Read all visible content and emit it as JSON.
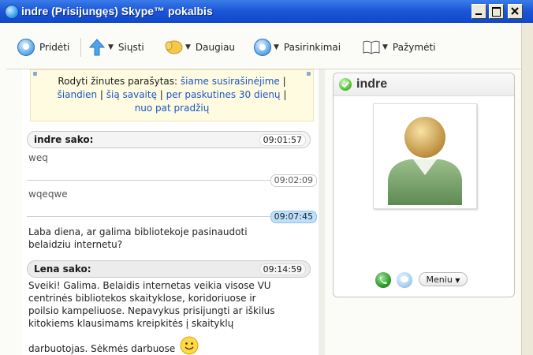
{
  "window": {
    "title": "indre (Prisijungęs) Skype™ pokalbis"
  },
  "toolbar": {
    "add_label": "Pridėti",
    "send_label": "Siųsti",
    "more_label": "Daugiau",
    "options_label": "Pasirinkimai",
    "mark_label": "Pažymėti"
  },
  "notice": {
    "prefix": "Rodyti žinutes parašytas:",
    "links": [
      "šiame susirašinėjime",
      "šiandien",
      "šią savaitę",
      "per paskutines 30 dienų",
      "nuo pat pradžių"
    ]
  },
  "messages": [
    {
      "sender": "indre sako:",
      "time": "09:01:57",
      "text": "weq"
    },
    {
      "time": "09:02:09",
      "text": "wqeqwe"
    },
    {
      "time": "09:07:45",
      "text": "Laba diena, ar galima bibliotekoje pasinaudoti belaidziu internetu?"
    },
    {
      "sender": "Lena sako:",
      "time": "09:14:59",
      "text_lines": [
        "Sveiki! Galima. Belaidis internetas veikia visose VU",
        "centrinės bibliotekos skaityklose, koridoriuose ir",
        "poilsio kampeliuose. Nepavykus prisijungti ar iškilus",
        "kitokiems klausimams kreipkitės į skaityklų",
        "darbuotojas. Sėkmės darbuose"
      ]
    }
  ],
  "contact": {
    "name": "indre",
    "menu_label": "Meniu"
  }
}
